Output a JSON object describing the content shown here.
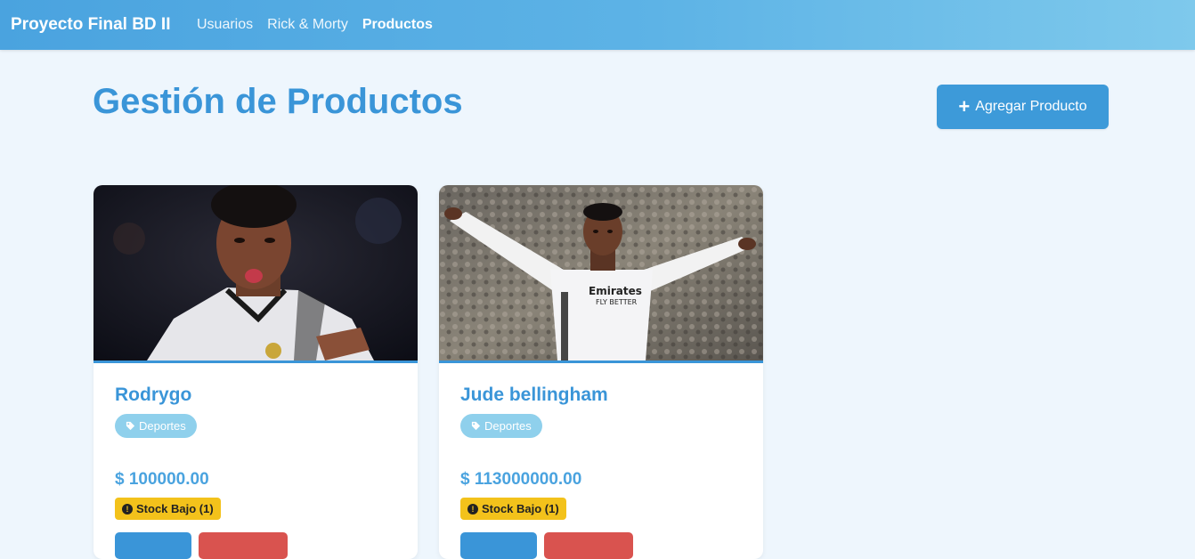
{
  "navbar": {
    "brand": "Proyecto Final BD II",
    "links": [
      {
        "label": "Usuarios",
        "active": false
      },
      {
        "label": "Rick & Morty",
        "active": false
      },
      {
        "label": "Productos",
        "active": true
      }
    ]
  },
  "page": {
    "title": "Gestión de Productos",
    "add_button_label": "Agregar Producto",
    "add_button_icon": "plus-icon"
  },
  "products": [
    {
      "name": "Rodrygo",
      "category": "Deportes",
      "category_icon": "tag-icon",
      "price": "$ 100000.00",
      "stock_label": "Stock Bajo (1)",
      "stock_icon": "exclamation-circle-icon"
    },
    {
      "name": "Jude bellingham",
      "category": "Deportes",
      "category_icon": "tag-icon",
      "price": "$ 113000000.00",
      "stock_label": "Stock Bajo (1)",
      "stock_icon": "exclamation-circle-icon"
    }
  ],
  "colors": {
    "accent": "#3a95d8",
    "navbar_start": "#4aa3df",
    "navbar_end": "#7ec9ec",
    "page_background": "#eef6fd",
    "category_badge": "#8fd0ec",
    "stock_warning": "#f3c21b",
    "delete": "#d9534f"
  }
}
